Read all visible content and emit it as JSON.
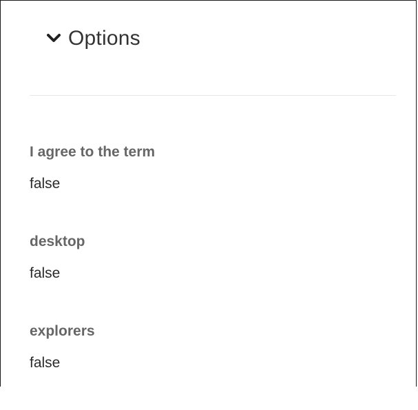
{
  "options": {
    "title": "Options",
    "toggle_icon": "chevron-down-icon"
  },
  "fields": [
    {
      "label": "I agree to the term",
      "value": "false"
    },
    {
      "label": "desktop",
      "value": "false"
    },
    {
      "label": "explorers",
      "value": "false"
    }
  ],
  "colors": {
    "text": "#222222",
    "label": "#666666",
    "divider": "#e6e6e6",
    "border": "#1a1a1a"
  }
}
